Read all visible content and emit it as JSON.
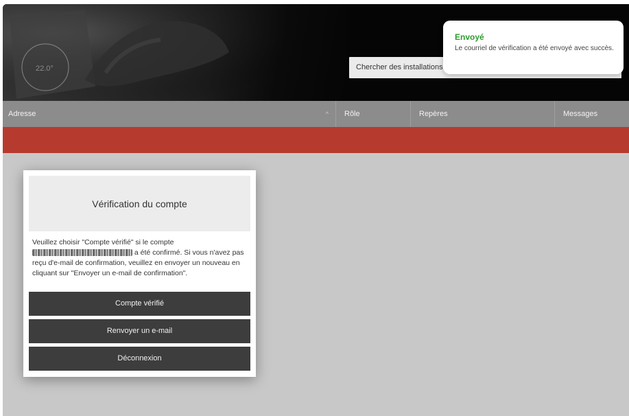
{
  "header": {
    "thermostat_reading": "22.0°",
    "search_label": "Chercher des installations"
  },
  "table": {
    "columns": [
      "Adresse",
      "Rôle",
      "Repères",
      "Messages"
    ],
    "sort_indicator": "^"
  },
  "modal": {
    "title": "Vérification du compte",
    "text_before": "Veuillez choisir \"Compte vérifié\" si le compte",
    "text_after": "a été confirmé. Si vous n'avez pas reçu d'e-mail de confirmation, veuillez en envoyer un nouveau en cliquant sur \"Envoyer un e-mail de confirmation\".",
    "buttons": {
      "verified": "Compte vérifié",
      "resend": "Renvoyer un e-mail",
      "logout": "Déconnexion"
    }
  },
  "toast": {
    "title": "Envoyé",
    "message": "Le courriel de vérification a été envoyé avec succès."
  },
  "colors": {
    "accent_red": "#b63b2e",
    "success_green": "#2e9c2e",
    "button_dark": "#3d3d3d"
  }
}
